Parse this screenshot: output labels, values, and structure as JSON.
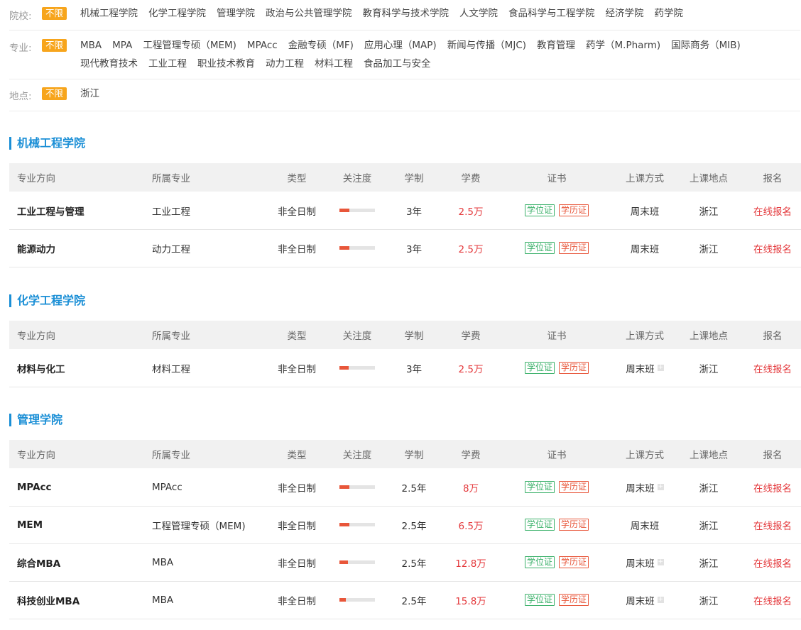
{
  "filters": {
    "school": {
      "label": "院校:",
      "all": "不限",
      "options": [
        "机械工程学院",
        "化学工程学院",
        "管理学院",
        "政治与公共管理学院",
        "教育科学与技术学院",
        "人文学院",
        "食品科学与工程学院",
        "经济学院",
        "药学院"
      ]
    },
    "major": {
      "label": "专业:",
      "all": "不限",
      "options": [
        "MBA",
        "MPA",
        "工程管理专硕（MEM)",
        "MPAcc",
        "金融专硕（MF)",
        "应用心理（MAP)",
        "新闻与传播（MJC)",
        "教育管理",
        "药学（M.Pharm)",
        "国际商务（MIB)",
        "现代教育技术",
        "工业工程",
        "职业技术教育",
        "动力工程",
        "材料工程",
        "食品加工与安全"
      ]
    },
    "location": {
      "label": "地点:",
      "all": "不限",
      "options": [
        "浙江"
      ]
    }
  },
  "table_headers": {
    "direction": "专业方向",
    "major": "所属专业",
    "type": "类型",
    "heat": "关注度",
    "length": "学制",
    "fee": "学费",
    "cert": "证书",
    "mode": "上课方式",
    "location": "上课地点",
    "apply": "报名"
  },
  "cert_labels": {
    "degree": "学位证",
    "diploma": "学历证"
  },
  "sections": [
    {
      "title": "机械工程学院",
      "rows": [
        {
          "direction": "工业工程与管理",
          "major": "工业工程",
          "type": "非全日制",
          "heat": 0.28,
          "length": "3年",
          "fee": "2.5万",
          "mode": "周末班",
          "has_more": false,
          "location": "浙江",
          "apply": "在线报名"
        },
        {
          "direction": "能源动力",
          "major": "动力工程",
          "type": "非全日制",
          "heat": 0.28,
          "length": "3年",
          "fee": "2.5万",
          "mode": "周末班",
          "has_more": false,
          "location": "浙江",
          "apply": "在线报名"
        }
      ]
    },
    {
      "title": "化学工程学院",
      "rows": [
        {
          "direction": "材料与化工",
          "major": "材料工程",
          "type": "非全日制",
          "heat": 0.26,
          "length": "3年",
          "fee": "2.5万",
          "mode": "周末班",
          "has_more": true,
          "location": "浙江",
          "apply": "在线报名"
        }
      ]
    },
    {
      "title": "管理学院",
      "rows": [
        {
          "direction": "MPAcc",
          "major": "MPAcc",
          "type": "非全日制",
          "heat": 0.28,
          "length": "2.5年",
          "fee": "8万",
          "mode": "周末班",
          "has_more": true,
          "location": "浙江",
          "apply": "在线报名"
        },
        {
          "direction": "MEM",
          "major": "工程管理专硕（MEM)",
          "type": "非全日制",
          "heat": 0.28,
          "length": "2.5年",
          "fee": "6.5万",
          "mode": "周末班",
          "has_more": false,
          "location": "浙江",
          "apply": "在线报名"
        },
        {
          "direction": "综合MBA",
          "major": "MBA",
          "type": "非全日制",
          "heat": 0.24,
          "length": "2.5年",
          "fee": "12.8万",
          "mode": "周末班",
          "has_more": true,
          "location": "浙江",
          "apply": "在线报名"
        },
        {
          "direction": "科技创业MBA",
          "major": "MBA",
          "type": "非全日制",
          "heat": 0.18,
          "length": "2.5年",
          "fee": "15.8万",
          "mode": "周末班",
          "has_more": true,
          "location": "浙江",
          "apply": "在线报名"
        }
      ]
    }
  ]
}
